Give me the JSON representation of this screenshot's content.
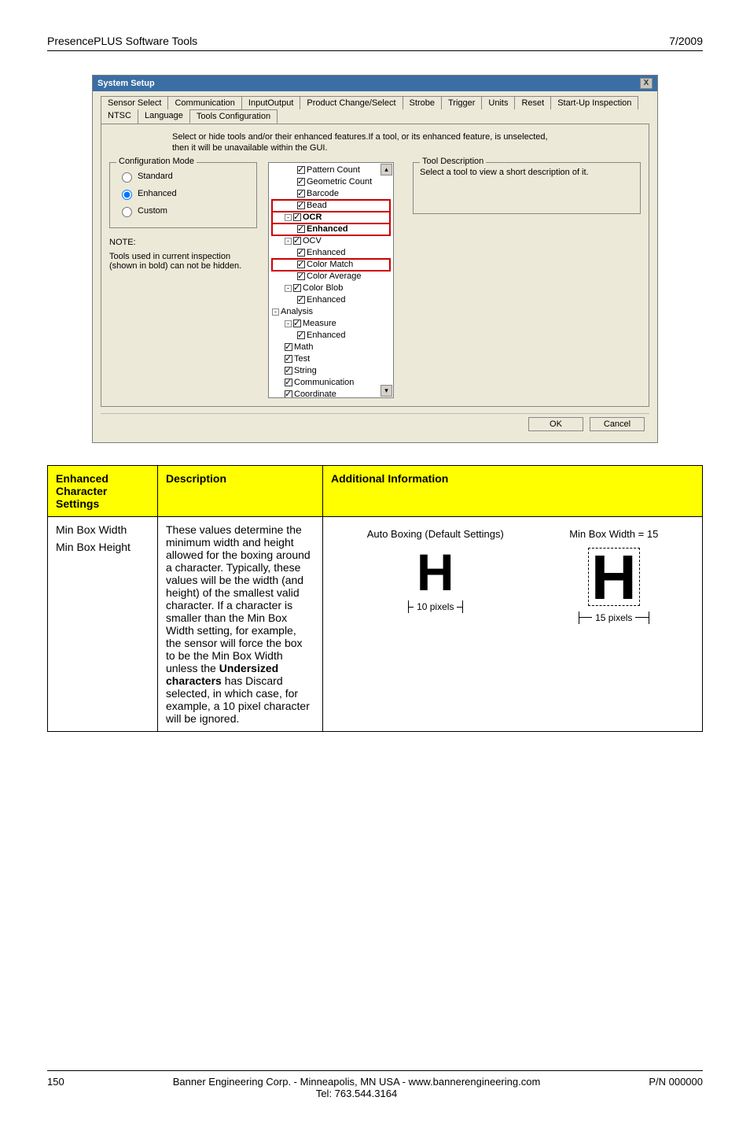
{
  "header": {
    "left": "PresencePLUS Software Tools",
    "right": "7/2009"
  },
  "dialog": {
    "title": "System Setup",
    "tabs_row1": [
      "Sensor Select",
      "Communication",
      "InputOutput",
      "Product Change/Select",
      "Strobe",
      "Trigger",
      "Units",
      "Reset",
      "Start-Up Inspection"
    ],
    "tabs_row2": [
      "NTSC",
      "Language",
      "Tools Configuration"
    ],
    "selected_tab": "Tools Configuration",
    "instructions": "Select or hide tools and/or their enhanced features.If a tool, or its enhanced feature, is unselected, then it will be unavailable within the GUI.",
    "config_mode": {
      "legend": "Configuration Mode",
      "options": [
        "Standard",
        "Enhanced",
        "Custom"
      ],
      "selected": "Enhanced"
    },
    "note_label": "NOTE:",
    "note_text": "Tools used in current inspection (shown in bold) can not be hidden.",
    "tool_desc": {
      "legend": "Tool Description",
      "text": "Select a tool to view a short description of it."
    },
    "tree": [
      {
        "lvl": 2,
        "cb": true,
        "label": "Pattern Count",
        "bold": false
      },
      {
        "lvl": 2,
        "cb": true,
        "label": "Geometric Count",
        "bold": false
      },
      {
        "lvl": 2,
        "cb": true,
        "label": "Barcode",
        "bold": false
      },
      {
        "lvl": 2,
        "cb": true,
        "label": "Bead",
        "bold": false,
        "hl": true
      },
      {
        "lvl": 1,
        "exp": "-",
        "cb": true,
        "label": "OCR",
        "bold": true,
        "hl": true
      },
      {
        "lvl": 2,
        "cb": true,
        "label": "Enhanced",
        "bold": true,
        "hl": true
      },
      {
        "lvl": 1,
        "exp": "-",
        "cb": true,
        "label": "OCV",
        "bold": false
      },
      {
        "lvl": 2,
        "cb": true,
        "label": "Enhanced",
        "bold": false
      },
      {
        "lvl": 2,
        "cb": true,
        "label": "Color Match",
        "bold": false,
        "hl": true
      },
      {
        "lvl": 2,
        "cb": true,
        "label": "Color Average",
        "bold": false
      },
      {
        "lvl": 1,
        "exp": "-",
        "cb": true,
        "label": "Color Blob",
        "bold": false
      },
      {
        "lvl": 2,
        "cb": true,
        "label": "Enhanced",
        "bold": false
      },
      {
        "lvl": 0,
        "exp": "-",
        "label": "Analysis",
        "bold": false
      },
      {
        "lvl": 1,
        "exp": "-",
        "cb": true,
        "label": "Measure",
        "bold": false
      },
      {
        "lvl": 2,
        "cb": true,
        "label": "Enhanced",
        "bold": false
      },
      {
        "lvl": 1,
        "cb": true,
        "label": "Math",
        "bold": false
      },
      {
        "lvl": 1,
        "cb": true,
        "label": "Test",
        "bold": false
      },
      {
        "lvl": 1,
        "cb": true,
        "label": "String",
        "bold": false
      },
      {
        "lvl": 1,
        "cb": true,
        "label": "Communication",
        "bold": false
      },
      {
        "lvl": 1,
        "cb": true,
        "label": "Coordinate",
        "bold": false
      }
    ],
    "buttons": {
      "ok": "OK",
      "cancel": "Cancel"
    }
  },
  "table": {
    "headers": [
      "Enhanced Character Settings",
      "Description",
      "Additional Information"
    ],
    "row": {
      "settings": [
        "Min Box Width",
        "Min Box Height"
      ],
      "description_pre": "These values determine the minimum width and height allowed for the boxing around a character. Typically, these values will be the width (and height) of the smallest valid character. If a character is smaller than the Min Box Width setting, for example, the sensor will force the box to be the Min Box Width unless the ",
      "description_bold": "Undersized characters",
      "description_post": "  has Discard selected, in which case, for example, a 10 pixel character will be ignored.",
      "illus": {
        "left_caption": "Auto Boxing (Default Settings)",
        "left_dim": "10 pixels",
        "right_caption": "Min Box Width = 15",
        "right_dim": "15 pixels"
      }
    }
  },
  "footer": {
    "page": "150",
    "mid1": "Banner Engineering Corp. - Minneapolis, MN USA - www.bannerengineering.com",
    "mid2": "Tel: 763.544.3164",
    "right": "P/N 000000"
  }
}
